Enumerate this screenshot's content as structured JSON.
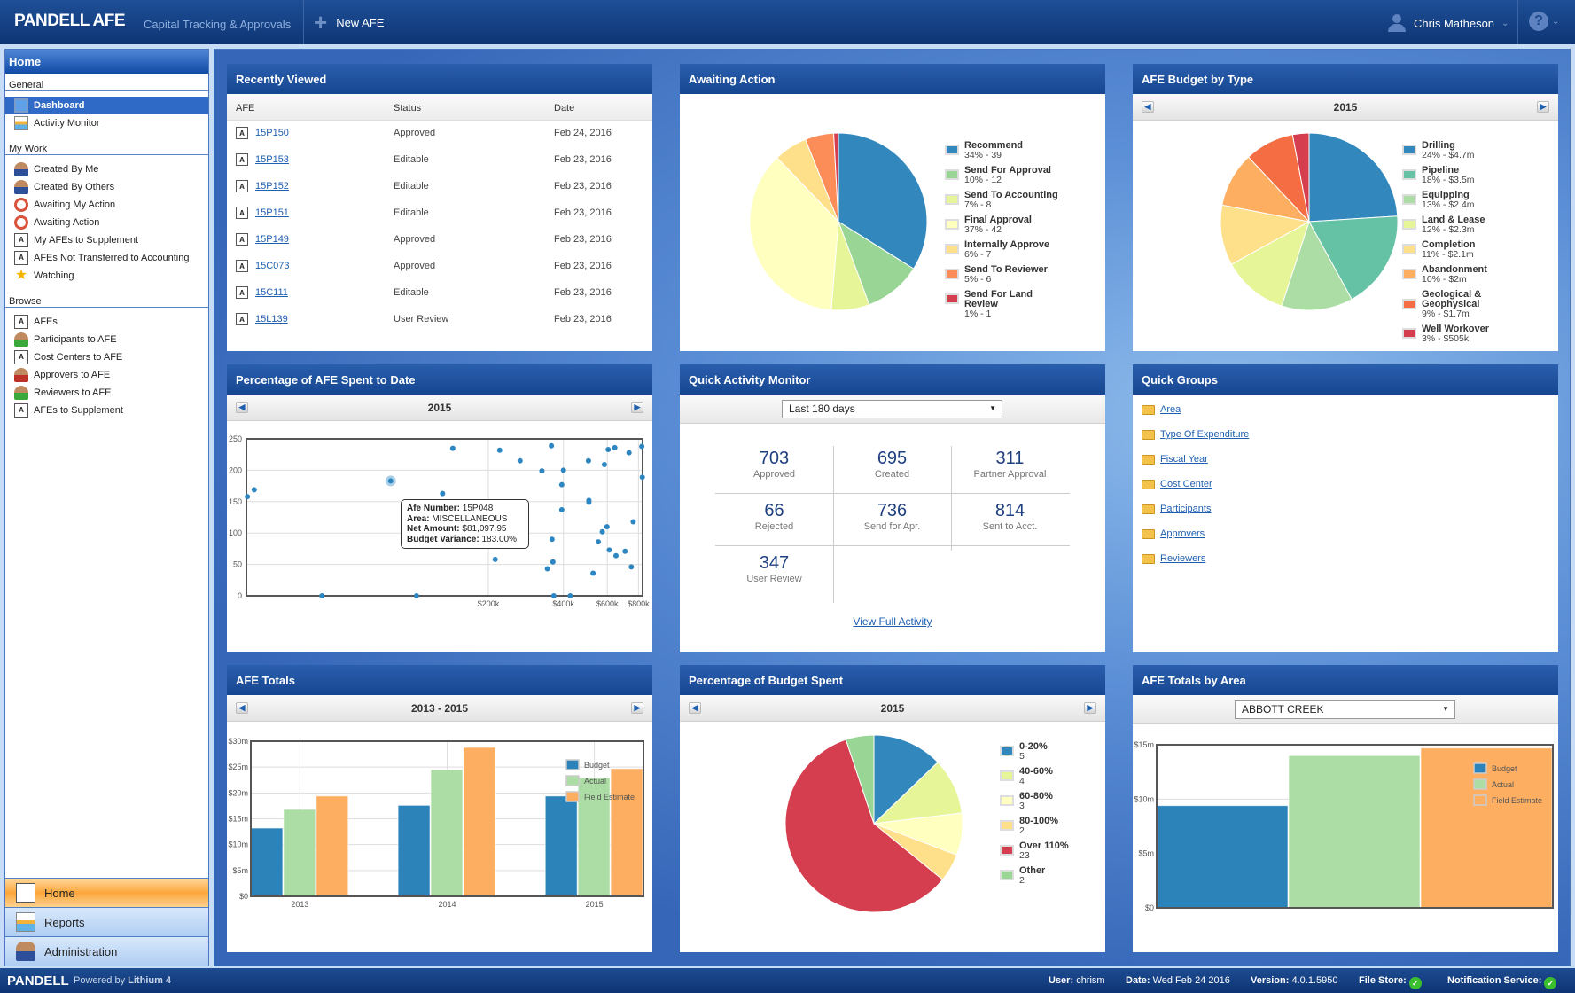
{
  "header": {
    "logo": "PANDELL AFE",
    "tagline": "Capital Tracking & Approvals",
    "new_afe": "New AFE",
    "user": "Chris Matheson",
    "help": "?"
  },
  "sidebar": {
    "title": "Home",
    "sections": [
      {
        "label": "General",
        "items": [
          {
            "label": "Dashboard",
            "icon": "dashboard-icon",
            "active": true
          },
          {
            "label": "Activity Monitor",
            "icon": "chart-icon"
          }
        ]
      },
      {
        "label": "My Work",
        "items": [
          {
            "label": "Created By Me",
            "icon": "person-icon"
          },
          {
            "label": "Created By Others",
            "icon": "person-icon"
          },
          {
            "label": "Awaiting My Action",
            "icon": "alarm-clock-icon"
          },
          {
            "label": "Awaiting Action",
            "icon": "alarm-clock-icon"
          },
          {
            "label": "My AFEs to Supplement",
            "icon": "afe-document-icon"
          },
          {
            "label": "AFEs Not Transferred to Accounting",
            "icon": "afe-document-icon"
          },
          {
            "label": "Watching",
            "icon": "star-icon"
          }
        ]
      },
      {
        "label": "Browse",
        "items": [
          {
            "label": "AFEs",
            "icon": "afe-document-icon"
          },
          {
            "label": "Participants to AFE",
            "icon": "person-green-icon"
          },
          {
            "label": "Cost Centers to AFE",
            "icon": "documents-icon"
          },
          {
            "label": "Approvers to AFE",
            "icon": "person-red-icon"
          },
          {
            "label": "Reviewers to AFE",
            "icon": "person-green-icon"
          },
          {
            "label": "AFEs to Supplement",
            "icon": "afe-document-icon"
          }
        ]
      }
    ],
    "bottom": [
      {
        "label": "Home",
        "icon": "house-icon",
        "active": true
      },
      {
        "label": "Reports",
        "icon": "report-icon"
      },
      {
        "label": "Administration",
        "icon": "admin-icon"
      }
    ]
  },
  "recently_viewed": {
    "title": "Recently Viewed",
    "columns": [
      "AFE",
      "Status",
      "Date"
    ],
    "rows": [
      [
        "15P150",
        "Approved",
        "Feb 24, 2016"
      ],
      [
        "15P153",
        "Editable",
        "Feb 23, 2016"
      ],
      [
        "15P152",
        "Editable",
        "Feb 23, 2016"
      ],
      [
        "15P151",
        "Editable",
        "Feb 23, 2016"
      ],
      [
        "15P149",
        "Approved",
        "Feb 23, 2016"
      ],
      [
        "15C073",
        "Approved",
        "Feb 23, 2016"
      ],
      [
        "15C111",
        "Editable",
        "Feb 23, 2016"
      ],
      [
        "15L139",
        "User Review",
        "Feb 23, 2016"
      ]
    ]
  },
  "awaiting_action": {
    "title": "Awaiting Action"
  },
  "budget_by_type": {
    "title": "AFE Budget by Type",
    "year": "2015"
  },
  "pct_spent": {
    "title": "Percentage of AFE Spent to Date",
    "year": "2015",
    "tooltip": {
      "k1": "Afe Number:",
      "v1": " 15P048",
      "k2": "Area:",
      "v2": " MISCELLANEOUS",
      "k3": "Net Amount:",
      "v3": " $81,097.95",
      "k4": "Budget Variance:",
      "v4": " 183.00%"
    }
  },
  "quick_activity": {
    "title": "Quick Activity Monitor",
    "range": "Last 180 days",
    "stats": [
      {
        "n": "703",
        "l": "Approved"
      },
      {
        "n": "695",
        "l": "Created"
      },
      {
        "n": "311",
        "l": "Partner Approval"
      },
      {
        "n": "66",
        "l": "Rejected"
      },
      {
        "n": "736",
        "l": "Send for Apr."
      },
      {
        "n": "814",
        "l": "Sent to Acct."
      },
      {
        "n": "347",
        "l": "User Review"
      }
    ],
    "link": "View Full Activity"
  },
  "quick_groups": {
    "title": "Quick Groups",
    "items": [
      "Area",
      "Type Of Expenditure",
      "Fiscal Year",
      "Cost Center",
      "Participants",
      "Approvers",
      "Reviewers"
    ]
  },
  "afe_totals": {
    "title": "AFE Totals",
    "range": "2013 - 2015"
  },
  "budget_spent": {
    "title": "Percentage of Budget Spent",
    "year": "2015"
  },
  "totals_by_area": {
    "title": "AFE Totals by Area",
    "area": "ABBOTT CREEK"
  },
  "footer": {
    "logo": "PANDELL",
    "powered": "Powered by ",
    "product": "Lithium 4",
    "user_k": "User:",
    "user_v": "chrism",
    "date_k": "Date:",
    "date_v": "Wed Feb 24 2016",
    "ver_k": "Version:",
    "ver_v": "4.0.1.5950",
    "fs": "File Store:",
    "ns": "Notification Service:",
    "status_color": "#3cbf2e"
  },
  "chart_data": [
    {
      "id": "awaiting",
      "type": "pie",
      "slices": [
        {
          "label": "Recommend",
          "sub": "34% - 39",
          "value": 39,
          "color": "#3288bd"
        },
        {
          "label": "Send For Approval",
          "sub": "10% - 12",
          "value": 12,
          "color": "#99d594"
        },
        {
          "label": "Send To Accounting",
          "sub": "7% - 8",
          "value": 8,
          "color": "#e6f598"
        },
        {
          "label": "Final Approval",
          "sub": "37% - 42",
          "value": 42,
          "color": "#ffffbf"
        },
        {
          "label": "Internally Approve",
          "sub": "6% - 7",
          "value": 7,
          "color": "#fee08b"
        },
        {
          "label": "Send To Reviewer",
          "sub": "5% - 6",
          "value": 6,
          "color": "#fc8d59"
        },
        {
          "label": "Send For Land Review",
          "sub": "1% - 1",
          "value": 1,
          "color": "#d53e4f"
        }
      ]
    },
    {
      "id": "bytype",
      "type": "pie",
      "slices": [
        {
          "label": "Drilling",
          "sub": "24% - $4.7m",
          "value": 24,
          "color": "#3288bd"
        },
        {
          "label": "Pipeline",
          "sub": "18% - $3.5m",
          "value": 18,
          "color": "#66c2a5"
        },
        {
          "label": "Equipping",
          "sub": "13% - $2.4m",
          "value": 13,
          "color": "#abdda4"
        },
        {
          "label": "Land & Lease",
          "sub": "12% - $2.3m",
          "value": 12,
          "color": "#e6f598"
        },
        {
          "label": "Completion",
          "sub": "11% - $2.1m",
          "value": 11,
          "color": "#fee08b"
        },
        {
          "label": "Abandonment",
          "sub": "10% - $2m",
          "value": 10,
          "color": "#fdae61"
        },
        {
          "label": "Geological & Geophysical",
          "sub": "9% - $1.7m",
          "value": 9,
          "color": "#f46d43"
        },
        {
          "label": "Well Workover",
          "sub": "3% - $505k",
          "value": 3,
          "color": "#d53e4f"
        }
      ]
    },
    {
      "id": "spent",
      "type": "pie",
      "slices": [
        {
          "label": "0-20%",
          "sub": "5",
          "value": 5,
          "color": "#3288bd"
        },
        {
          "label": "40-60%",
          "sub": "4",
          "value": 4,
          "color": "#e6f598"
        },
        {
          "label": "60-80%",
          "sub": "3",
          "value": 3,
          "color": "#ffffbf"
        },
        {
          "label": "80-100%",
          "sub": "2",
          "value": 2,
          "color": "#fee08b"
        },
        {
          "label": "Over 110%",
          "sub": "23",
          "value": 23,
          "color": "#d53e4f"
        },
        {
          "label": "Other",
          "sub": "2",
          "value": 2,
          "color": "#99d594"
        }
      ]
    },
    {
      "id": "scatter",
      "type": "scatter",
      "xscale": "log",
      "xlim": [
        21400,
        831000
      ],
      "ylim": [
        0,
        250
      ],
      "xticks": [
        {
          "v": 200000,
          "l": "$200k"
        },
        {
          "v": 400000,
          "l": "$400k"
        },
        {
          "v": 600000,
          "l": "$600k"
        },
        {
          "v": 800000,
          "l": "$800k"
        }
      ],
      "yticks": [
        0,
        50,
        100,
        150,
        200,
        250
      ],
      "color": "#2e86c1",
      "highlight": 3,
      "points": [
        [
          21600,
          158
        ],
        [
          23000,
          169
        ],
        [
          43000,
          0
        ],
        [
          81098,
          183
        ],
        [
          103000,
          0
        ],
        [
          131000,
          163
        ],
        [
          144000,
          235
        ],
        [
          213000,
          58
        ],
        [
          222000,
          232
        ],
        [
          268000,
          215
        ],
        [
          328000,
          199
        ],
        [
          345000,
          43
        ],
        [
          358000,
          239
        ],
        [
          360000,
          90
        ],
        [
          363000,
          54
        ],
        [
          366000,
          0
        ],
        [
          394000,
          137
        ],
        [
          394000,
          177
        ],
        [
          400000,
          200
        ],
        [
          426000,
          0
        ],
        [
          504000,
          215
        ],
        [
          506000,
          152
        ],
        [
          506000,
          149
        ],
        [
          526000,
          36
        ],
        [
          552000,
          86
        ],
        [
          573000,
          102
        ],
        [
          584000,
          209
        ],
        [
          598000,
          110
        ],
        [
          605000,
          233
        ],
        [
          611000,
          73
        ],
        [
          643000,
          236
        ],
        [
          650000,
          64
        ],
        [
          707000,
          71
        ],
        [
          733000,
          228
        ],
        [
          749000,
          46
        ],
        [
          762000,
          118
        ],
        [
          825000,
          238
        ],
        [
          829000,
          189
        ]
      ]
    },
    {
      "id": "totals",
      "type": "bar",
      "categories": [
        "2013",
        "2014",
        "2015"
      ],
      "ylim": [
        0,
        30
      ],
      "yticks": [
        "$0",
        "$5m",
        "$10m",
        "$15m",
        "$20m",
        "$25m",
        "$30m"
      ],
      "series": [
        {
          "name": "Budget",
          "color": "#2b83ba",
          "values": [
            13.2,
            17.6,
            19.4
          ]
        },
        {
          "name": "Actual",
          "color": "#abdda4",
          "values": [
            16.8,
            24.5,
            22.9
          ]
        },
        {
          "name": "Field Estimate",
          "color": "#fdae61",
          "values": [
            19.4,
            28.8,
            24.7
          ]
        }
      ]
    },
    {
      "id": "area",
      "type": "bar",
      "categories": [
        "ABBOTT CREEK"
      ],
      "ylim": [
        0,
        15
      ],
      "yticks": [
        "$0",
        "$5m",
        "$10m",
        "$15m"
      ],
      "series": [
        {
          "name": "Budget",
          "color": "#2b83ba",
          "values": [
            9.4
          ]
        },
        {
          "name": "Actual",
          "color": "#abdda4",
          "values": [
            14.0
          ]
        },
        {
          "name": "Field Estimate",
          "color": "#fdae61",
          "values": [
            14.7
          ]
        }
      ]
    }
  ]
}
